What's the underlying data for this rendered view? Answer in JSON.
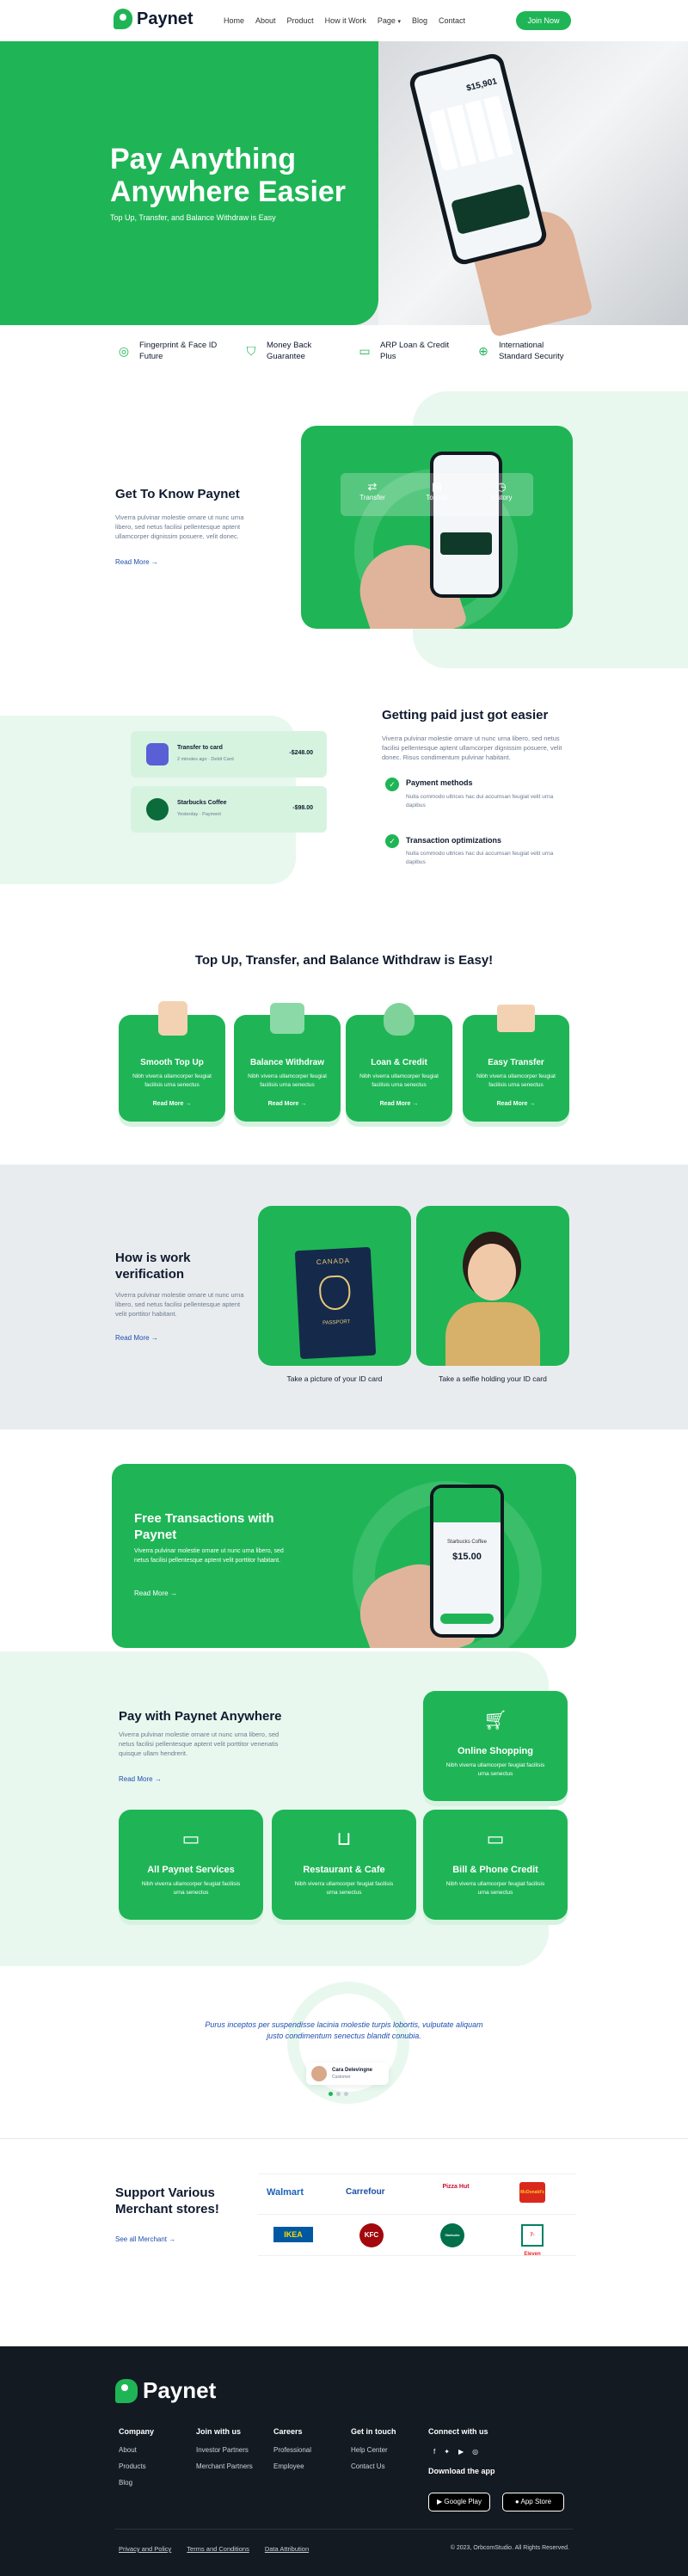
{
  "brand": {
    "name": "Paynet",
    "primary": "#1fb556",
    "dark": "#0f1a2e"
  },
  "nav": {
    "items": [
      "Home",
      "About",
      "Product",
      "How it Work",
      "Page",
      "Blog",
      "Contact"
    ],
    "cta": "Join Now"
  },
  "hero": {
    "title_line1": "Pay Anything",
    "title_line2": "Anywhere Easier",
    "subtitle": "Top Up, Transfer, and Balance Withdraw is Easy",
    "phone_balance": "$15,901"
  },
  "features": [
    {
      "icon": "fingerprint-icon",
      "line1": "Fingerprint & Face ID",
      "line2": "Future"
    },
    {
      "icon": "shield-icon",
      "line1": "Money Back",
      "line2": "Guarantee"
    },
    {
      "icon": "card-icon",
      "line1": "ARP Loan & Credit",
      "line2": "Plus"
    },
    {
      "icon": "globe-icon",
      "line1": "International",
      "line2": "Standard Security"
    }
  ],
  "know": {
    "title": "Get To Know Paynet",
    "body": "Viverra pulvinar molestie ornare ut nunc urna libero, sed netus facilisi pellentesque aptent ullamcorper dignissim posuere, velit donec.",
    "link": "Read More",
    "actions": [
      "Transfer",
      "Top Up",
      "History"
    ]
  },
  "paid": {
    "title": "Getting paid just got easier",
    "body": "Viverra pulvinar molestie ornare ut nunc urna libero, sed netus facilisi pellentesque aptent ullamcorper dignissim posuere, velit donec. Risus condimentum pulvinar habitant.",
    "items": [
      {
        "title": "Payment methods",
        "body": "Nulla commodo ultrices hac dui accumsan feugiat velit urna dapibus"
      },
      {
        "title": "Transaction optimizations",
        "body": "Nulla commodo ultrices hac dui accumsan feugiat velit urna dapibus"
      }
    ],
    "transactions": [
      {
        "name": "Transfer to card",
        "meta": "2 minutes ago  ·  Debit Card",
        "amount": "-$248.00"
      },
      {
        "name": "Starbucks Coffee",
        "meta": "Yesterday  ·  Payment",
        "amount": "-$98.00"
      }
    ]
  },
  "services": {
    "title": "Top Up, Transfer, and Balance Withdraw is Easy!",
    "items": [
      {
        "title": "Smooth Top Up",
        "body": "Nibh viverra ullamcorper feugiat facilisis urna senectus",
        "link": "Read More"
      },
      {
        "title": "Balance Withdraw",
        "body": "Nibh viverra ullamcorper feugiat facilisis urna senectus",
        "link": "Read More"
      },
      {
        "title": "Loan & Credit",
        "body": "Nibh viverra ullamcorper feugiat facilisis urna senectus",
        "link": "Read More"
      },
      {
        "title": "Easy Transfer",
        "body": "Nibh viverra ullamcorper feugiat facilisis urna senectus",
        "link": "Read More"
      }
    ]
  },
  "verify": {
    "title_line1": "How is work",
    "title_line2": "verification",
    "body": "Viverra pulvinar molestie ornare ut nunc urna libero, sed netus facilisi pellentesque aptent velit porttitor habitant.",
    "link": "Read More",
    "passport_country": "CANADA",
    "passport_label": "PASSPORT",
    "captions": [
      "Take a picture of your ID card",
      "Take a selfie holding your ID card"
    ]
  },
  "free": {
    "title_line1": "Free Transactions with",
    "title_line2": "Paynet",
    "body": "Viverra pulvinar molestie ornare ut nunc urna libero, sed netus facilisi pellentesque aptent velit porttitor habitant.",
    "link": "Read More",
    "phone_title": "Starbucks Coffee",
    "phone_amount": "$15.00"
  },
  "anywhere": {
    "title": "Pay with Paynet Anywhere",
    "body": "Viverra pulvinar molestie ornare ut nunc urna libero, sed netus facilisi pellentesque aptent velit porttitor venenatis quisque ullam hendrerit.",
    "link": "Read More",
    "items": [
      {
        "title": "Online Shopping",
        "body": "Nibh viverra ullamcorper feugiat facilisis urna senectus",
        "icon": "cart-icon"
      },
      {
        "title": "All Paynet Services",
        "body": "Nibh viverra ullamcorper feugiat facilisis urna senectus",
        "icon": "wallet-icon"
      },
      {
        "title": "Restaurant & Cafe",
        "body": "Nibh viverra ullamcorper feugiat facilisis urna senectus",
        "icon": "basket-icon"
      },
      {
        "title": "Bill & Phone Credit",
        "body": "Nibh viverra ullamcorper feugiat facilisis urna senectus",
        "icon": "card-icon"
      }
    ]
  },
  "testimonial": {
    "quote_line1": "Purus inceptos per suspendisse lacinia molestie turpis lobortis, vulputate aliquam",
    "quote_line2": "justo condimentum senectus blandit conubia.",
    "name": "Cara Delevingne",
    "role": "Customer"
  },
  "merchants": {
    "title_line1": "Support Various",
    "title_line2": "Merchant stores!",
    "link": "See all Merchant",
    "logos": [
      "Walmart",
      "Carrefour",
      "Pizza Hut",
      "McDonald's",
      "IKEA",
      "KFC",
      "Starbucks",
      "7-Eleven"
    ]
  },
  "footer": {
    "brand": "Paynet",
    "columns": [
      {
        "heading": "Company",
        "links": [
          "About",
          "Products",
          "Blog"
        ]
      },
      {
        "heading": "Join with us",
        "links": [
          "Investor Partners",
          "Merchant Partners"
        ]
      },
      {
        "heading": "Careers",
        "links": [
          "Professional",
          "Employee"
        ]
      },
      {
        "heading": "Get in touch",
        "links": [
          "Help Center",
          "Contact Us"
        ]
      }
    ],
    "connect": "Connect with us",
    "download": "Download the app",
    "google_play": "Google Play",
    "app_store": "App Store",
    "legal": [
      "Privacy and Policy",
      "Terms and Conditions",
      "Data Attribution"
    ],
    "copyright": "© 2023, OrbcomStudio. All Rights Reserved."
  }
}
